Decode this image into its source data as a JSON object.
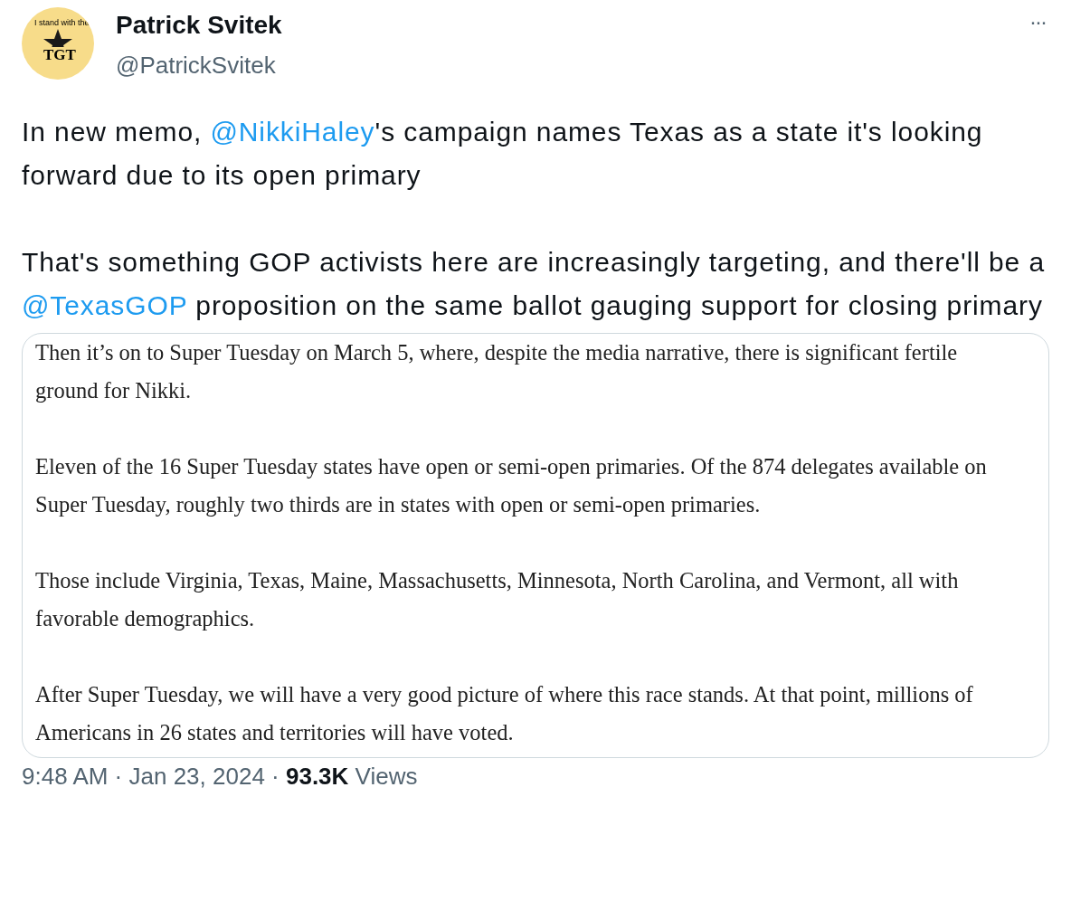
{
  "author": {
    "name": "Patrick Svitek",
    "handle": "@PatrickSvitek",
    "avatar_texts": [
      "I stand with the",
      "TGT"
    ]
  },
  "more": "···",
  "tweet": [
    [
      {
        "kind": "text",
        "text": "In new memo, "
      },
      {
        "kind": "mention",
        "text": "@NikkiHaley"
      },
      {
        "kind": "text",
        "text": "'s campaign names Texas as a state it's looking forward due to its open primary"
      }
    ],
    [
      {
        "kind": "text",
        "text": "That's something GOP activists here are increasingly targeting, and there'll be a "
      },
      {
        "kind": "mention",
        "text": "@TexasGOP"
      },
      {
        "kind": "text",
        "text": " proposition on the same ballot gauging support for closing primary"
      }
    ]
  ],
  "document": [
    "Then it’s on to Super Tuesday on March 5, where, despite the media narrative, there is significant fertile ground for Nikki.",
    "Eleven of the 16 Super Tuesday states have open or semi-open primaries. Of the 874 delegates available on Super Tuesday, roughly two thirds are in states with open or semi-open primaries.",
    "Those include Virginia, Texas, Maine, Massachusetts, Minnesota, North Carolina, and Vermont, all with favorable demographics.",
    "After Super Tuesday, we will have a very good picture of where this race stands. At that point, millions of Americans in 26 states and territories will have voted."
  ],
  "footer": "9:48 AM · Jan 23, 2024 · **93.3K** Views"
}
